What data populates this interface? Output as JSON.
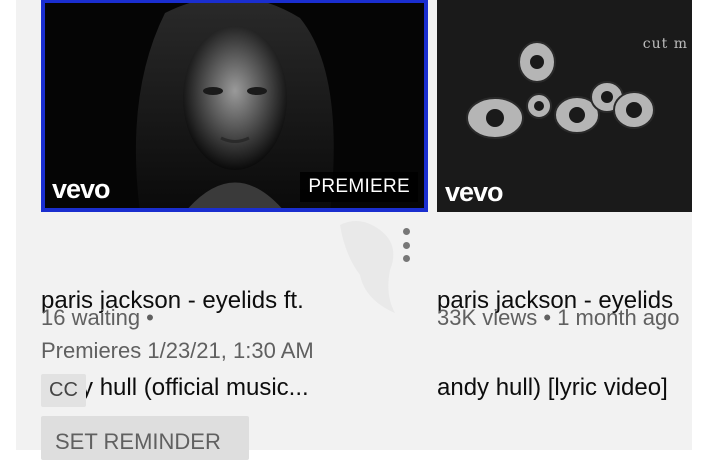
{
  "videos": [
    {
      "brand": "vevo",
      "badge": "PREMIERE",
      "title_line1": "paris jackson - eyelids ft.",
      "title_line2": "andy hull (official music...",
      "waiting": "16 waiting •",
      "premiere_time": "Premieres 1/23/21, 1:30 AM",
      "cc_label": "CC",
      "reminder_label": "SET REMINDER",
      "selected": true,
      "accent_color": "#1a2ecf",
      "menu_icon": "more-vert-icon"
    },
    {
      "brand": "vevo",
      "overlay_text": "cut m",
      "title_line1": "paris jackson - eyelids",
      "title_line2": "andy hull) [lyric video]",
      "stats": "33K views • 1 month ago"
    }
  ]
}
